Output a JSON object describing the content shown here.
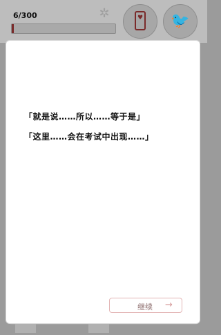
{
  "top_bar": {
    "progress_text": "6/300",
    "progress_value": 0.02
  },
  "icons": {
    "phone": "phone-heart-icon",
    "twitter": "twitter-bird-icon",
    "sparkle": "sparkle-icon"
  },
  "dialog": {
    "lines": [
      "「就是说……所以……等于是」",
      "「这里……会在考试中出现……」"
    ],
    "continue_label": "继续",
    "continue_arrow": "→"
  },
  "colors": {
    "accent": "#7a2a2a",
    "button_border": "#e3b4b4"
  }
}
